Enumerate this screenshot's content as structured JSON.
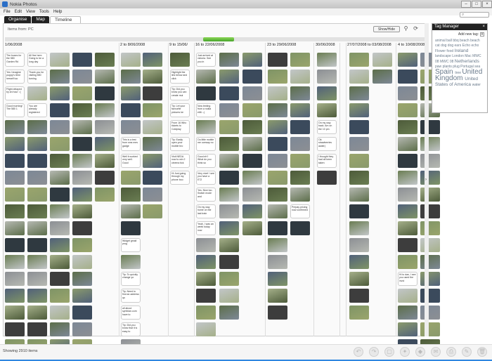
{
  "app": {
    "title": "Nokia Photos"
  },
  "menu": [
    "File",
    "Edit",
    "View",
    "Tools",
    "Help"
  ],
  "tabs": [
    "Organise",
    "Map",
    "Timeline"
  ],
  "timeline": {
    "source_label": "Items from: PC",
    "show_hide_label": "Show/Hide",
    "date_groups": [
      "1/06/2008",
      "2 to 8/06/2008",
      "9 to 15/06/",
      "16 to 22/06/2008",
      "23 to 29/06/2008",
      "30/06/2008",
      "27/07/2008 to 03/08/2008",
      "4 to 10/08/2008"
    ],
    "notes": [
      [
        "The buses for the 580 Garden Rd",
        "Yes I imagine puppy's tired herself too",
        "Flight delayed by an hour ::(",
        "Good morning! The 580 1"
      ],
      [
        "All fine here. Going to be a long day",
        "Thank you for visiting 580 turning",
        "You are already registered"
      ],
      [
        "This is a test from sms mes gadge",
        "Well it worked very well. Good",
        "Widget gmail prog",
        "Tip: To quickly change yo",
        "Tip: Need to find an address qu",
        "all about symbian.com have to",
        "Tip: Did you know that it is easy to"
      ],
      [
        "Highlight the link below and click",
        "Tip: Did you know you can create mul",
        "Tip: Let your favourite pictures ke",
        "From 16 Who tickets to Coldplay",
        "Tip: Easily open your mobile bro",
        "Visit NEDA now to win 2 cinema tick",
        "Hi Just going through my phone boo"
      ],
      [
        "Just arrived at victoria. See you in",
        "Now texting from a nokia e66 :-)",
        "Oo little mobile me conway no",
        "Good eh? What do you think so",
        "Very nice! I see you have a E72",
        "Yes. Nice too. Switch mode and",
        "On my way home on the last train",
        "Yeah, I was an week today now"
      ],
      [
        "Prepay pricing now confirmed"
      ],
      [
        "On my way back. Am on the 10 pm",
        "Ok strawberries await:)",
        "I thought they had all been taken"
      ],
      [
        "Hi to dan, I see you used the invoi"
      ]
    ]
  },
  "tag_manager": {
    "title": "Tag Manager",
    "add_label": "Add new tag:",
    "tags": [
      "animal",
      "ball",
      "bbq",
      "beach",
      "beach",
      "cat",
      "dog",
      "dog",
      "ears",
      "Echo",
      "echo",
      "Flower",
      "food",
      "Ireland",
      "landscape",
      "London",
      "Mac",
      "MWC 08",
      "MWC 08",
      "Netherlands",
      "paw",
      "plants",
      "plug",
      "Portugal",
      "sea",
      "Spain",
      "tree",
      "United Kingdom",
      "United States of America",
      "water"
    ]
  },
  "status": {
    "items_label": "Showing 2910 items"
  },
  "colors": {
    "accent": "#46a32a",
    "tag_text": "#6b7b8c",
    "tab_dark": "#222222",
    "progress": "#2f87e0"
  }
}
